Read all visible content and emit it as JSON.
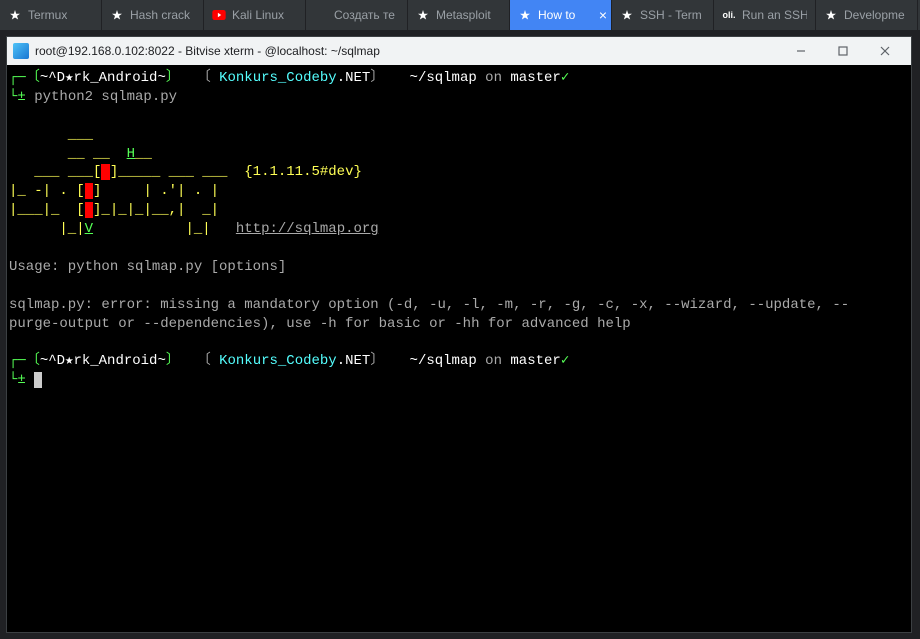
{
  "taskbar": {
    "tabs": [
      {
        "title": "Termux",
        "icon": "star"
      },
      {
        "title": "Hash crack",
        "icon": "star"
      },
      {
        "title": "Kali Linux",
        "icon": "youtube"
      },
      {
        "title": "Создать те",
        "icon": "none"
      },
      {
        "title": "Metasploit",
        "icon": "star"
      },
      {
        "title": "How to",
        "icon": "star",
        "active": true
      },
      {
        "title": "SSH - Term",
        "icon": "star"
      },
      {
        "title": "Run an SSH",
        "icon": "oli"
      },
      {
        "title": "Developme",
        "icon": "star"
      }
    ]
  },
  "window": {
    "title": "root@192.168.0.102:8022 - Bitvise xterm - @localhost: ~/sqlmap"
  },
  "terminal": {
    "prompt1_host": "~^D★rk_Android~",
    "prompt1_ctx_a": "Konkurs_Codeby",
    "prompt1_ctx_b": ".NET",
    "prompt1_path": "~/sqlmap",
    "prompt1_branch": "master",
    "prompt1_cmd": "python2 sqlmap.py",
    "banner_version": "{1.1.11.5#dev}",
    "banner_url": "http://sqlmap.org",
    "usage_line": "Usage: python sqlmap.py [options]",
    "error_line1": "sqlmap.py: error: missing a mandatory option (-d, -u, -l, -m, -r, -g, -c, -x, --wizard, --update, --",
    "error_line2": "purge-output or --dependencies), use -h for basic or -hh for advanced help",
    "prompt2_host": "~^D★rk_Android~",
    "prompt2_ctx_a": "Konkurs_Codeby",
    "prompt2_ctx_b": ".NET",
    "prompt2_path": "~/sqlmap",
    "prompt2_branch": "master",
    "on_text": "on",
    "check": "✓",
    "prompt_sym_top": "┌─",
    "prompt_sym_bot": "└",
    "prompt_sym_dollar": "±",
    "bracket_open": "〔",
    "bracket_close": "〕",
    "banner_h": "H",
    "banner_v": "V",
    "banner_art1": "       ___",
    "banner_art2": "       __ __",
    "banner_art3a": "  ___ ___[",
    "banner_art3b": "]_____ ___ ___",
    "banner_art4a": "|_ -| . [",
    "banner_art4b": "]     | .'| . |",
    "banner_art5a": "|___|_  [",
    "banner_art5b": "]_|_|_|__,|  _|",
    "banner_art6": "      |_|",
    "banner_art6b": "           |_|"
  }
}
